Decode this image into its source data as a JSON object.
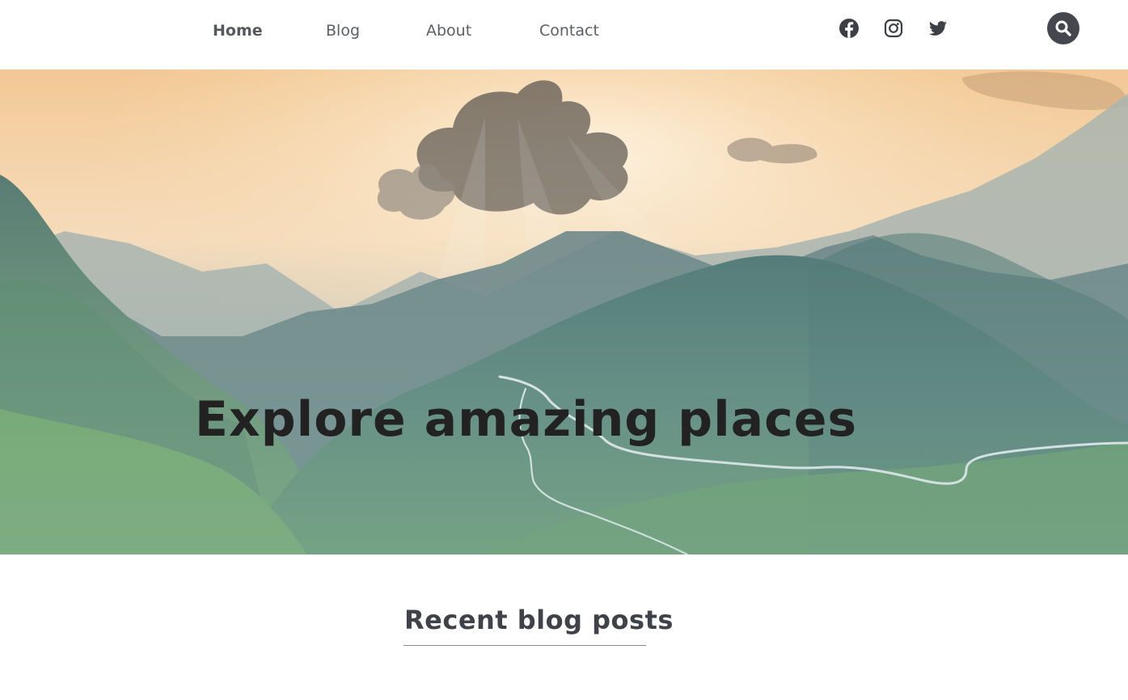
{
  "nav": {
    "items": [
      {
        "label": "Home",
        "active": true
      },
      {
        "label": "Blog",
        "active": false
      },
      {
        "label": "About",
        "active": false
      },
      {
        "label": "Contact",
        "active": false
      }
    ]
  },
  "social": {
    "icons": [
      "facebook-icon",
      "instagram-icon",
      "twitter-icon"
    ],
    "color": "#3c3f45"
  },
  "search": {
    "icon": "search-icon",
    "background": "#44474e"
  },
  "hero": {
    "title": "Explore amazing places",
    "image": "misty-mountains-valley-road"
  },
  "recent": {
    "title": "Recent blog posts"
  }
}
